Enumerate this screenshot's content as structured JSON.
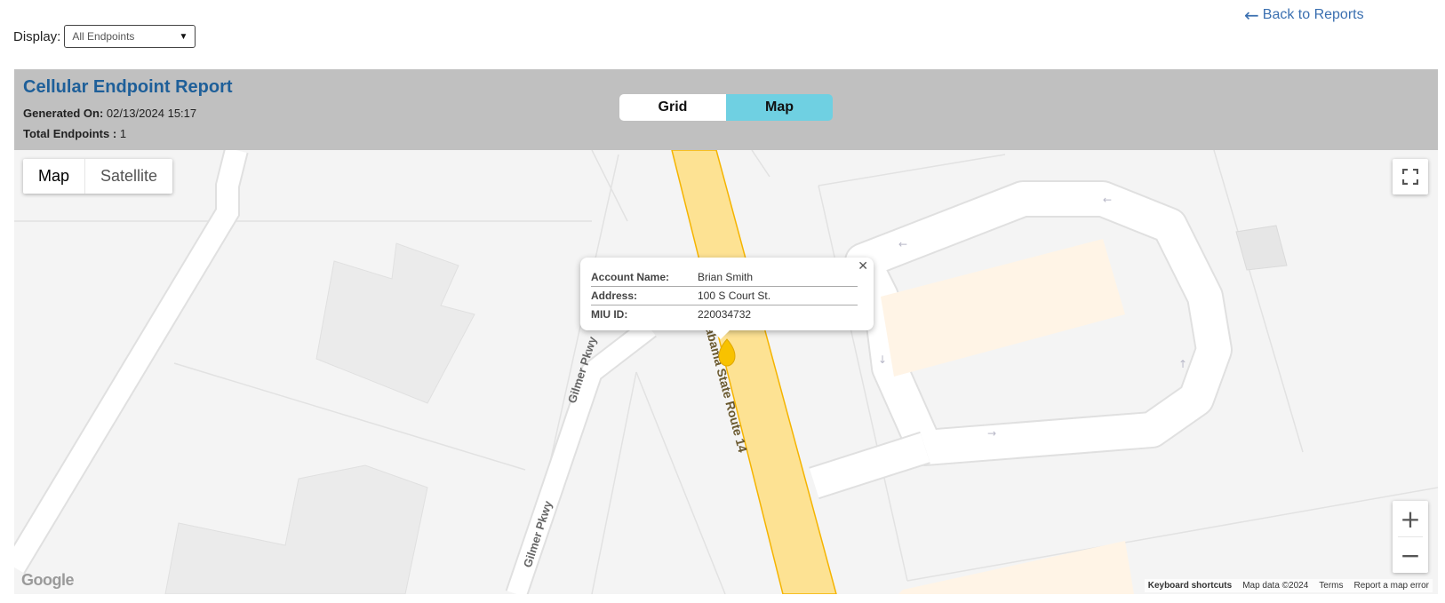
{
  "back_link": {
    "icon": "arrow-left-icon",
    "label": "Back to Reports"
  },
  "display": {
    "label": "Display:",
    "selected": "All Endpoints"
  },
  "report": {
    "title": "Cellular Endpoint Report",
    "generated_label": "Generated On:",
    "generated_value": "02/13/2024 15:17",
    "total_label": "Total Endpoints :",
    "total_value": "1"
  },
  "view_toggle": {
    "grid_label": "Grid",
    "map_label": "Map",
    "active": "Map"
  },
  "map": {
    "type_controls": {
      "map_label": "Map",
      "satellite_label": "Satellite",
      "active": "Map"
    },
    "road_labels": {
      "route": "Alabama State Route 14",
      "street1": "Gilmer Pkwy",
      "street2": "Gilmer Pkwy"
    },
    "info_window": {
      "rows": [
        {
          "key": "Account Name:",
          "value": "Brian Smith"
        },
        {
          "key": "Address:",
          "value": "100 S Court St."
        },
        {
          "key": "MIU ID:",
          "value": "220034732"
        }
      ]
    },
    "logo": "Google",
    "attribution": {
      "shortcuts": "Keyboard shortcuts",
      "data": "Map data ©2024",
      "terms": "Terms",
      "report": "Report a map error"
    },
    "colors": {
      "highway": "#fde293",
      "highway_border": "#f5b400",
      "pin": "#f8c200",
      "building": "#ececec",
      "commercial": "#fff4e6"
    }
  }
}
